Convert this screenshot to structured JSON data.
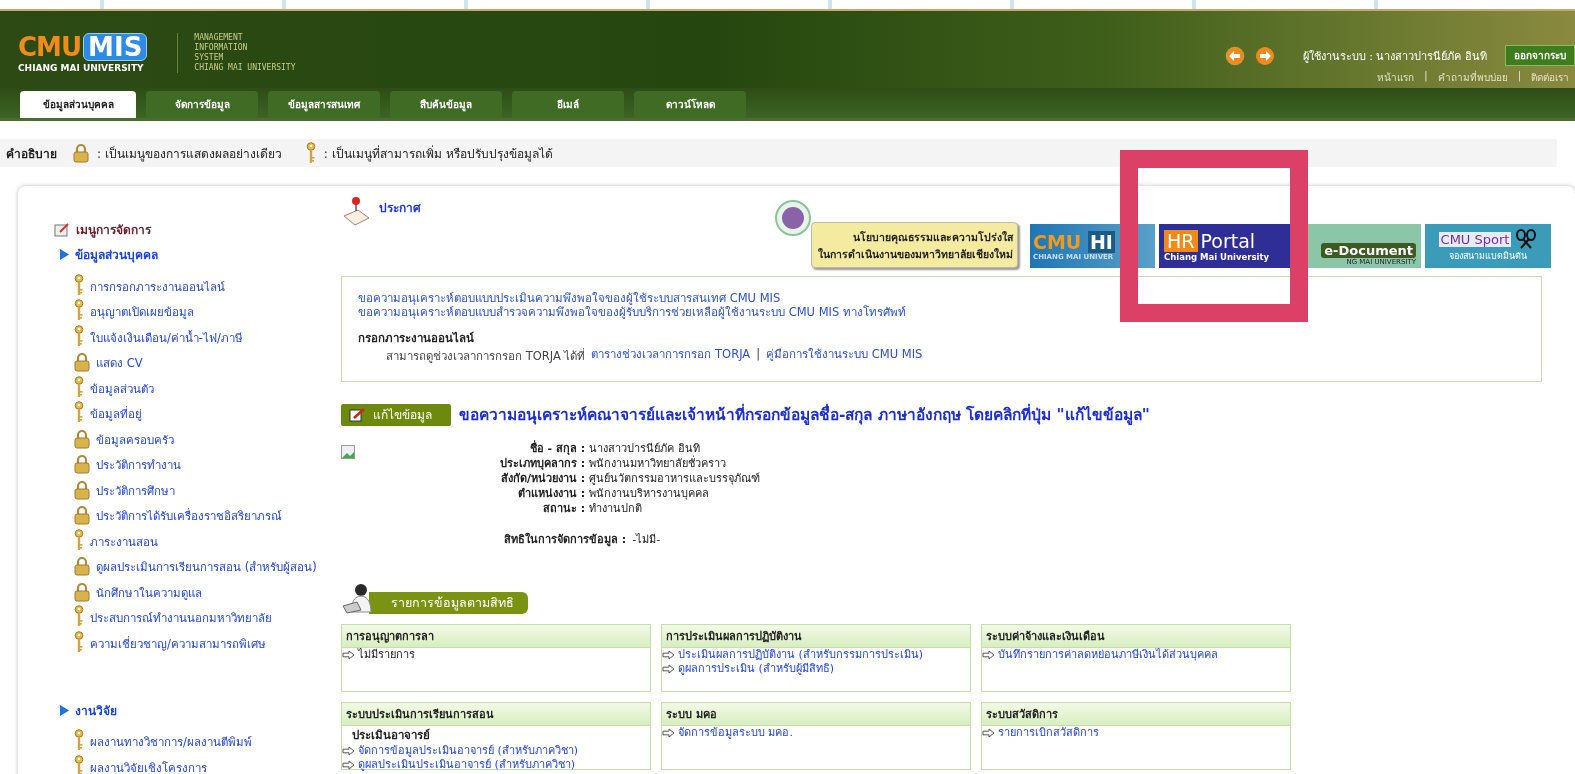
{
  "header": {
    "logo": {
      "mark_left": "CMU",
      "mark_right": "MIS",
      "subtitle": "CHIANG MAI UNIVERSITY"
    },
    "system_name": [
      "MANAGEMENT",
      "INFORMATION",
      "SYSTEM",
      "CHIANG MAI UNIVERSITY"
    ],
    "user_label": "ผู้ใช้งานระบบ : นางสาวปารนีย์ภัค อินทิ",
    "logout": "ออกจากระบ",
    "links": [
      {
        "text": "หน้าแรก"
      },
      {
        "separator": "|",
        "text": "คำถามที่พบบ่อย"
      },
      {
        "separator": "|",
        "text": "ติดต่อเรา"
      }
    ],
    "tabs": [
      {
        "label": "ข้อมูลส่วนบุคคล",
        "selected": true
      },
      {
        "label": "จัดการข้อมูล",
        "selected": false
      },
      {
        "label": "ข้อมูลสารสนเทศ",
        "selected": false
      },
      {
        "label": "สืบค้นข้อมูล",
        "selected": false
      },
      {
        "label": "อีเมล์",
        "selected": false
      },
      {
        "label": "ดาวน์โหลด",
        "selected": false
      }
    ]
  },
  "legend": {
    "label": "คำอธิบาย",
    "items": [
      {
        "kind": "lock",
        "text": ": เป็นเมนูของการแสดงผลอย่างเดียว"
      },
      {
        "kind": "key",
        "text": ": เป็นเมนูที่สามารถเพิ่ม หรือปรับปรุงข้อมูลได้"
      }
    ]
  },
  "sidebar": {
    "title": "เมนูการจัดการ",
    "groups": [
      {
        "label": "ข้อมูลส่วนบุคคล",
        "items": [
          {
            "kind": "key",
            "label": "การกรอกภาระงานออนไลน์"
          },
          {
            "kind": "key",
            "label": "อนุญาตเปิดเผยข้อมูล"
          },
          {
            "kind": "key",
            "label": "ใบแจ้งเงินเดือน/ค่าน้ำ-ไฟ/ภาษี"
          },
          {
            "kind": "lock",
            "label": "แสดง CV"
          },
          {
            "kind": "key",
            "label": "ข้อมูลส่วนตัว"
          },
          {
            "kind": "key",
            "label": "ข้อมูลที่อยู่"
          },
          {
            "kind": "lock",
            "label": "ข้อมูลครอบครัว"
          },
          {
            "kind": "lock",
            "label": "ประวัติการทำงาน"
          },
          {
            "kind": "lock",
            "label": "ประวัติการศึกษา"
          },
          {
            "kind": "lock",
            "label": "ประวัติการได้รับเครื่องราชอิสริยาภรณ์"
          },
          {
            "kind": "key",
            "label": "ภาระงานสอน"
          },
          {
            "kind": "lock",
            "label": "ดูผลประเมินการเรียนการสอน (สำหรับผู้สอน)"
          },
          {
            "kind": "lock",
            "label": "นักศึกษาในความดูแล"
          },
          {
            "kind": "key",
            "label": "ประสบการณ์ทำงานนอกมหาวิทยาลัย"
          },
          {
            "kind": "key",
            "label": "ความเชี่ยวชาญ/ความสามารถพิเศษ"
          }
        ]
      },
      {
        "label": "งานวิจัย",
        "items": [
          {
            "kind": "key",
            "label": "ผลงานทางวิชาการ/ผลงานตีพิมพ์"
          },
          {
            "kind": "key",
            "label": "ผลงานวิจัยเชิงโครงการ"
          }
        ]
      }
    ]
  },
  "announcement": {
    "title": "ประกาศ",
    "policy_note": [
      "นโยบายคุณธรรมและความโปร่งใส",
      "ในการดำเนินงานของมหาวิทยาลัยเชียงใหม่"
    ],
    "banners": [
      {
        "kind": "cmu_hr",
        "title_a": "CMU",
        "title_b": "HI",
        "subtitle": "CHIANG MAI UNIVER"
      },
      {
        "kind": "hr_portal",
        "title_a": "HR",
        "title_b": "Portal",
        "subtitle": "Chiang Mai University"
      },
      {
        "kind": "edocument",
        "title_a": "e-Document",
        "subtitle": "NG MAI UNIVERSITY"
      },
      {
        "kind": "sport",
        "title_a": "CMU Sport",
        "subtitle": "จองสนามแบดมินตัน"
      }
    ]
  },
  "info_box": {
    "links": [
      "ขอความอนุเคราะห์ตอบแบบประเมินความพึงพอใจของผู้ใช้ระบบสารสนเทศ CMU MIS",
      "ขอความอนุเคราะห์ตอบแบบสำรวจความพึงพอใจของผู้รับบริการช่วยเหลือผู้ใช้งานระบบ CMU MIS ทางโทรศัพท์"
    ],
    "heading": "กรอกภาระงานออนไลน์",
    "text": "สามารถดูช่วงเวลาการกรอก TORJA ได้ที่",
    "link_a": "ตารางช่วงเวลาการกรอก TORJA",
    "separator": "|",
    "link_b": "คู่มือการใช้งานระบบ CMU MIS"
  },
  "edit": {
    "button": "แก้ไขข้อมูล",
    "message": "ขอความอนุเคราะห์คณาจารย์และเจ้าหน้าที่กรอกข้อมูลชื่อ-สกุล ภาษาอังกฤษ โดยคลิกที่ปุ่ม \"แก้ไขข้อมูล\""
  },
  "profile": {
    "fields": [
      {
        "label": "ชื่อ - สกุล :",
        "value": "นางสาวปารนีย์ภัค อินทิ"
      },
      {
        "label": "ประเภทบุคลากร :",
        "value": "พนักงานมหาวิทยาลัยชั่วคราว"
      },
      {
        "label": "สังกัด/หน่วยงาน :",
        "value": "ศูนย์นวัตกรรมอาหารและบรรจุภัณฑ์"
      },
      {
        "label": "ตำแหน่งงาน :",
        "value": "พนักงานบริหารงานบุคคล"
      },
      {
        "label": "สถานะ :",
        "value": "ทำงานปกติ"
      }
    ],
    "rights_label": "สิทธิในการจัดการข้อมูล :",
    "rights_value": "-ไม่มี-"
  },
  "rights_section": {
    "title": "รายการข้อมูลตามสิทธิ",
    "panels": [
      {
        "title": "การอนุญาตการลา",
        "items": [
          {
            "kind": "plain",
            "text": "ไม่มีรายการ"
          }
        ]
      },
      {
        "title": "การประเมินผลการปฏิบัติงาน",
        "items": [
          {
            "kind": "link",
            "text": "ประเมินผลการปฏิบัติงาน (สำหรับกรรมการประเมิน)"
          },
          {
            "kind": "link",
            "text": "ดูผลการประเมิน (สำหรับผู้มีสิทธิ)"
          }
        ]
      },
      {
        "title": "ระบบค่าจ้างและเงินเดือน",
        "items": [
          {
            "kind": "link",
            "text": "บันทึกรายการค่าลดหย่อนภาษีเงินได้ส่วนบุคคล"
          }
        ]
      },
      {
        "title": "ระบบประเมินการเรียนการสอน",
        "subheading": "ประเมินอาจารย์",
        "items": [
          {
            "kind": "link",
            "text": "จัดการข้อมูลประเมินอาจารย์ (สำหรับภาควิชา)"
          },
          {
            "kind": "link",
            "text": "ดูผลประเมินประเมินอาจารย์ (สำหรับภาควิชา)"
          }
        ]
      },
      {
        "title": "ระบบ มคอ",
        "items": [
          {
            "kind": "link",
            "text": "จัดการข้อมูลระบบ มคอ."
          }
        ]
      },
      {
        "title": "ระบบสวัสดิการ",
        "items": [
          {
            "kind": "link",
            "text": "รายการเบิกสวัสดิการ"
          }
        ]
      }
    ]
  }
}
